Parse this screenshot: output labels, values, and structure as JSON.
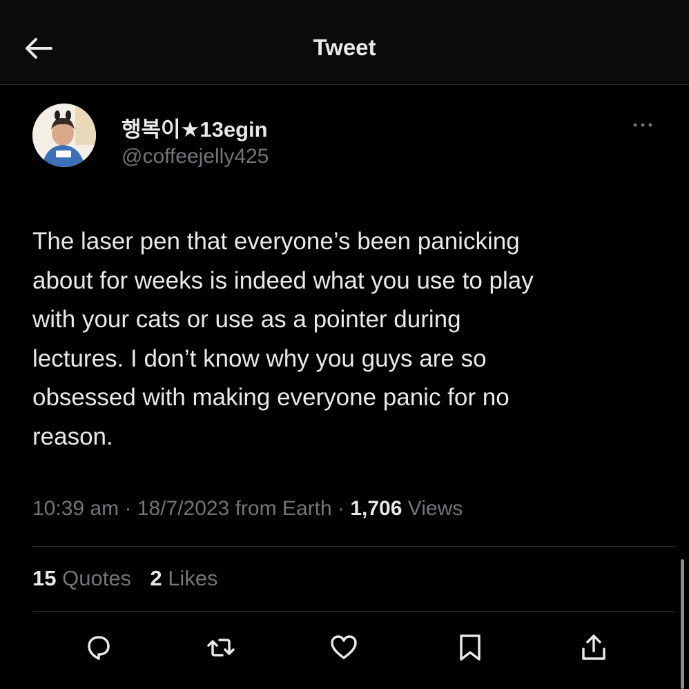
{
  "header": {
    "title": "Tweet",
    "back_icon": "arrow-left-icon"
  },
  "author": {
    "display_name": "행복이★13egin",
    "handle": "@coffeejelly425",
    "avatar": "avatar-photo"
  },
  "tweet": {
    "text": "The laser pen that everyone’s been panicking\nabout for weeks is indeed what you use to play\nwith your cats or use as a pointer during\nlectures. I don’t know why you guys are so\nobsessed with making everyone panic for no\nreason.",
    "time": "10:39 am",
    "date": "18/7/2023",
    "source": "from Earth",
    "views_count": "1,706",
    "views_label": "Views",
    "separator": "·"
  },
  "stats": {
    "quotes_count": "15",
    "quotes_label": "Quotes",
    "likes_count": "2",
    "likes_label": "Likes"
  },
  "actions": [
    {
      "icon": "reply-icon"
    },
    {
      "icon": "retweet-icon"
    },
    {
      "icon": "like-icon"
    },
    {
      "icon": "bookmark-icon"
    },
    {
      "icon": "share-icon"
    }
  ],
  "colors": {
    "background": "#000000",
    "text_primary": "#e7e9ea",
    "text_secondary": "#71767b",
    "divider": "#2a2d30"
  }
}
